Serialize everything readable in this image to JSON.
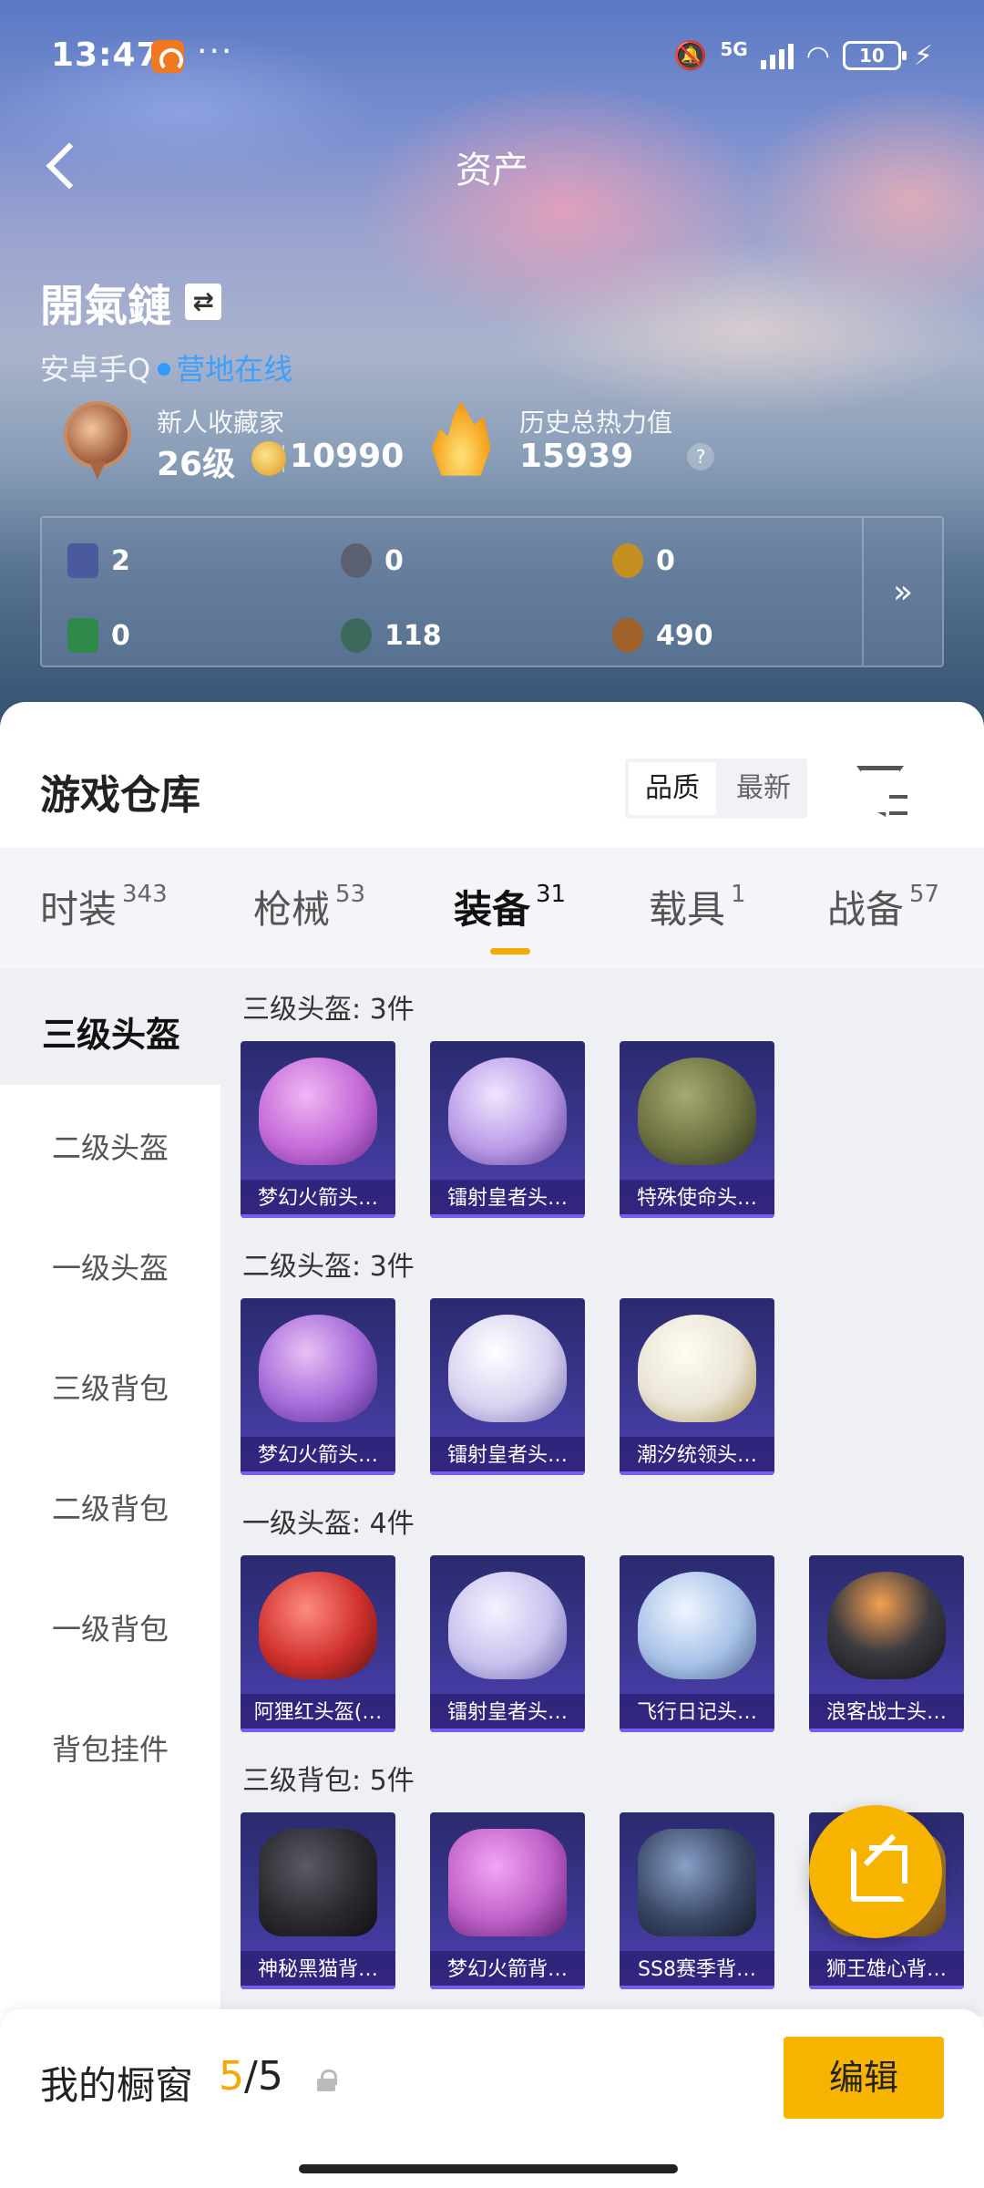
{
  "status_bar": {
    "time": "13:47",
    "more": "···",
    "network": "5G",
    "battery": "10"
  },
  "header": {
    "title": "资产"
  },
  "user": {
    "name": "開氣鏈",
    "swap_glyph": "⇄",
    "platform": "安卓手Q",
    "status": "营地在线",
    "rank_title": "新人收藏家",
    "level": "26级",
    "coins": "10990",
    "heat_title": "历史总热力值",
    "heat_value": "15939",
    "help": "?"
  },
  "resources": [
    {
      "icon": "card-icon",
      "color": "#4a5a9c",
      "value": "2"
    },
    {
      "icon": "silver-coin-icon",
      "color": "#5b6070",
      "value": "0"
    },
    {
      "icon": "gold-coin-icon",
      "color": "#c49020",
      "value": "0"
    },
    {
      "icon": "green-card-icon",
      "color": "#2f8a4a",
      "value": "0"
    },
    {
      "icon": "jade-orb-icon",
      "color": "#3c6a5a",
      "value": "118"
    },
    {
      "icon": "bronze-orb-icon",
      "color": "#a0622a",
      "value": "490"
    }
  ],
  "resources_more": "»",
  "warehouse": {
    "title": "游戏仓库",
    "sort_options": [
      "品质",
      "最新"
    ],
    "tabs": [
      {
        "label": "时装",
        "count": "343"
      },
      {
        "label": "枪械",
        "count": "53"
      },
      {
        "label": "装备",
        "count": "31"
      },
      {
        "label": "载具",
        "count": "1"
      },
      {
        "label": "战备",
        "count": "57"
      }
    ],
    "categories": [
      "三级头盔",
      "二级头盔",
      "一级头盔",
      "三级背包",
      "二级背包",
      "一级背包",
      "背包挂件"
    ],
    "sections": [
      {
        "title": "三级头盔: 3件",
        "items": [
          {
            "name": "梦幻火箭头…",
            "color": "#c46ad8"
          },
          {
            "name": "镭射皇者头…",
            "color": "#b89ae6"
          },
          {
            "name": "特殊使命头…",
            "color": "#6b7040"
          }
        ]
      },
      {
        "title": "二级头盔: 3件",
        "items": [
          {
            "name": "梦幻火箭头…",
            "color": "#a56ad8"
          },
          {
            "name": "镭射皇者头…",
            "color": "#d8d2f0"
          },
          {
            "name": "潮汐统领头…",
            "color": "#e9e4d6"
          }
        ]
      },
      {
        "title": "一级头盔: 4件",
        "items": [
          {
            "name": "阿狸红头盔(…",
            "color": "#d0302c"
          },
          {
            "name": "镭射皇者头…",
            "color": "#c8c2ee"
          },
          {
            "name": "飞行日记头…",
            "color": "#a8c2e8"
          },
          {
            "name": "浪客战士头…",
            "color": "#3a3a40"
          }
        ]
      },
      {
        "title": "三级背包: 5件",
        "items": [
          {
            "name": "神秘黑猫背…",
            "color": "#2a2a30"
          },
          {
            "name": "梦幻火箭背…",
            "color": "#c060c8"
          },
          {
            "name": "SS8赛季背…",
            "color": "#3a4866"
          },
          {
            "name": "狮王雄心背…",
            "color": "#c09040"
          }
        ]
      }
    ]
  },
  "showcase": {
    "label": "我的橱窗",
    "current": "5",
    "total": "/5",
    "edit": "编辑"
  }
}
